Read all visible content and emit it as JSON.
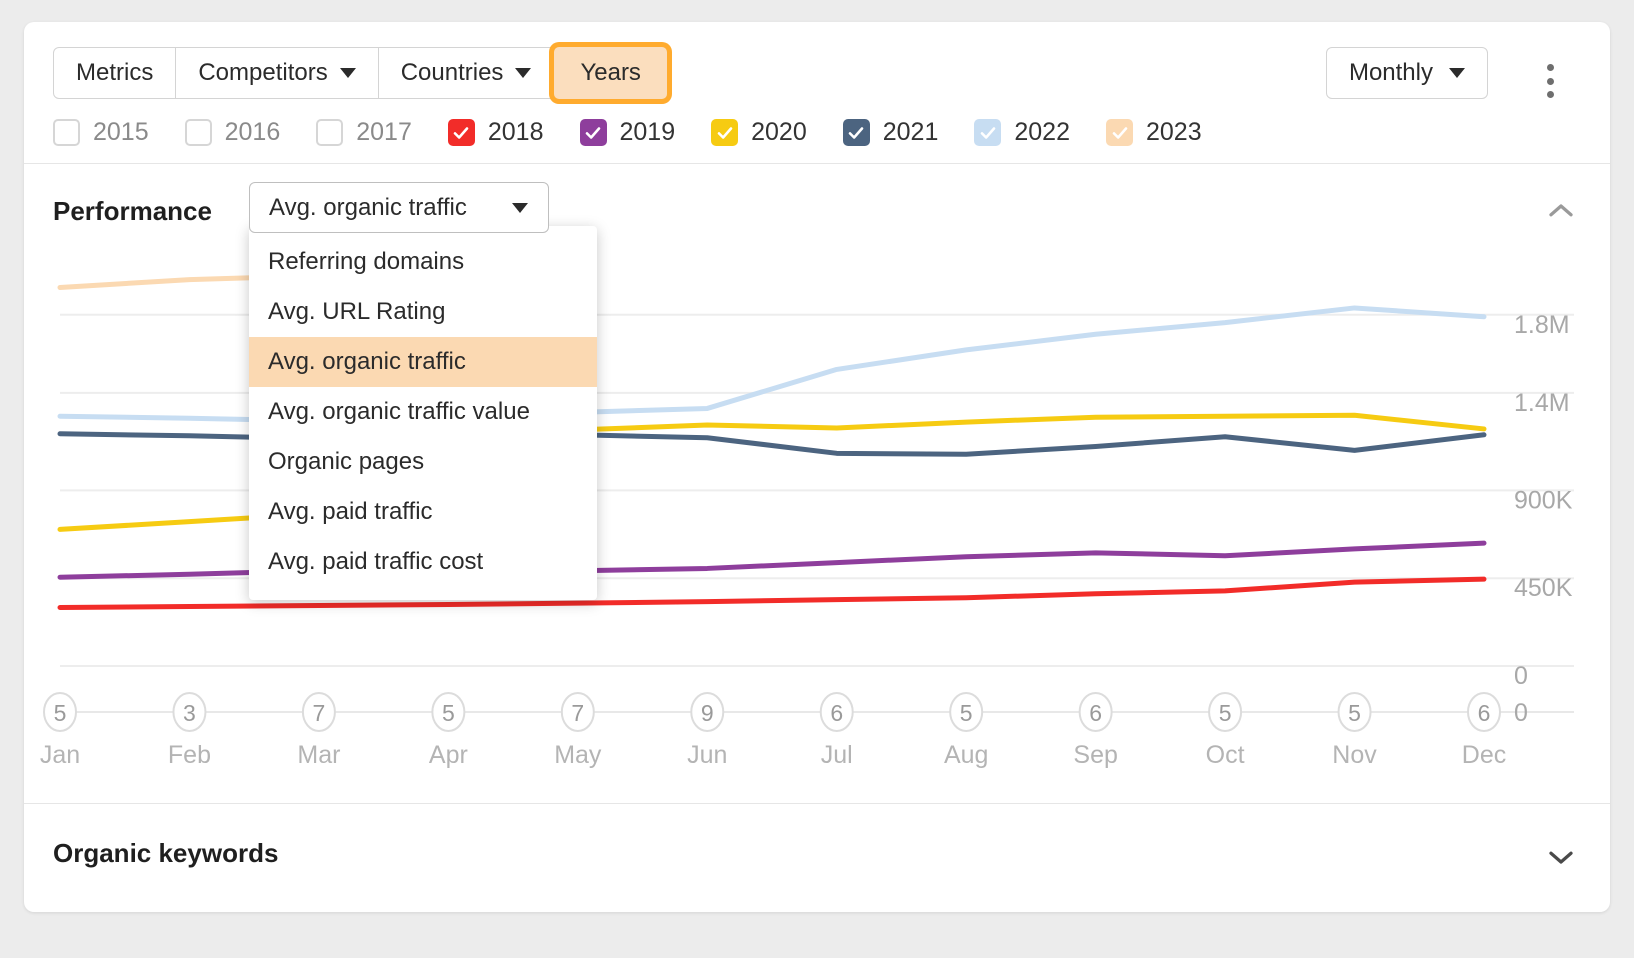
{
  "toolbar": {
    "buttons": [
      {
        "label": "Metrics",
        "has_caret": false,
        "active": false
      },
      {
        "label": "Competitors",
        "has_caret": true,
        "active": false
      },
      {
        "label": "Countries",
        "has_caret": true,
        "active": false
      },
      {
        "label": "Years",
        "has_caret": false,
        "active": true
      }
    ],
    "period_label": "Monthly",
    "more_menu": "kebab-menu"
  },
  "years": [
    {
      "label": "2015",
      "checked": false,
      "color": "#FFFFFF"
    },
    {
      "label": "2016",
      "checked": false,
      "color": "#FFFFFF"
    },
    {
      "label": "2017",
      "checked": false,
      "color": "#FFFFFF"
    },
    {
      "label": "2018",
      "checked": true,
      "color": "#F22C29"
    },
    {
      "label": "2019",
      "checked": true,
      "color": "#8E3E9C"
    },
    {
      "label": "2020",
      "checked": true,
      "color": "#F6CB12"
    },
    {
      "label": "2021",
      "checked": true,
      "color": "#4C6480"
    },
    {
      "label": "2022",
      "checked": true,
      "color": "#C7DDF2"
    },
    {
      "label": "2023",
      "checked": true,
      "color": "#FBD9B2"
    }
  ],
  "performance": {
    "title": "Performance",
    "selected_metric": "Avg. organic traffic",
    "collapse_icon": "chevron-up-icon",
    "dropdown_options": [
      "Referring domains",
      "Avg. URL Rating",
      "Avg. organic traffic",
      "Avg. organic traffic value",
      "Organic pages",
      "Avg. paid traffic",
      "Avg. paid traffic cost"
    ]
  },
  "organic_keywords": {
    "title": "Organic keywords",
    "expand_icon": "chevron-down-icon"
  },
  "chart_data": {
    "type": "line",
    "title": "Performance — Avg. organic traffic",
    "xlabel": "",
    "ylabel": "",
    "grid": true,
    "legend_position": "top-checkboxes",
    "categories": [
      "Jan",
      "Feb",
      "Mar",
      "Apr",
      "May",
      "Jun",
      "Jul",
      "Aug",
      "Sep",
      "Oct",
      "Nov",
      "Dec"
    ],
    "point_counts": [
      5,
      3,
      7,
      5,
      7,
      9,
      6,
      5,
      6,
      5,
      5,
      6
    ],
    "ytick_labels": [
      "1.8M",
      "1.4M",
      "900K",
      "450K",
      "0"
    ],
    "ytick_values": [
      1800000,
      1400000,
      900000,
      450000,
      0
    ],
    "ylim": [
      0,
      2050000
    ],
    "series": [
      {
        "name": "2023",
        "color": "#FBD9B2",
        "values": [
          1940000,
          1980000,
          2000000,
          2010000,
          null,
          null,
          null,
          null,
          null,
          null,
          null,
          null
        ]
      },
      {
        "name": "2022",
        "color": "#C7DDF2",
        "values": [
          1280000,
          1270000,
          1255000,
          1265000,
          1300000,
          1320000,
          1520000,
          1620000,
          1700000,
          1760000,
          1835000,
          1790000
        ]
      },
      {
        "name": "2021",
        "color": "#4C6480",
        "values": [
          1190000,
          1180000,
          1165000,
          1175000,
          1185000,
          1170000,
          1090000,
          1085000,
          1125000,
          1175000,
          1105000,
          1185000
        ]
      },
      {
        "name": "2020",
        "color": "#F6CB12",
        "values": [
          700000,
          740000,
          780000,
          1185000,
          1210000,
          1235000,
          1220000,
          1250000,
          1275000,
          1280000,
          1285000,
          1215000
        ]
      },
      {
        "name": "2019",
        "color": "#8E3E9C",
        "values": [
          455000,
          470000,
          490000,
          498000,
          488000,
          500000,
          530000,
          560000,
          580000,
          565000,
          600000,
          630000
        ]
      },
      {
        "name": "2018",
        "color": "#F22C29",
        "values": [
          300000,
          305000,
          310000,
          315000,
          322000,
          330000,
          340000,
          350000,
          370000,
          385000,
          430000,
          445000
        ]
      }
    ]
  }
}
